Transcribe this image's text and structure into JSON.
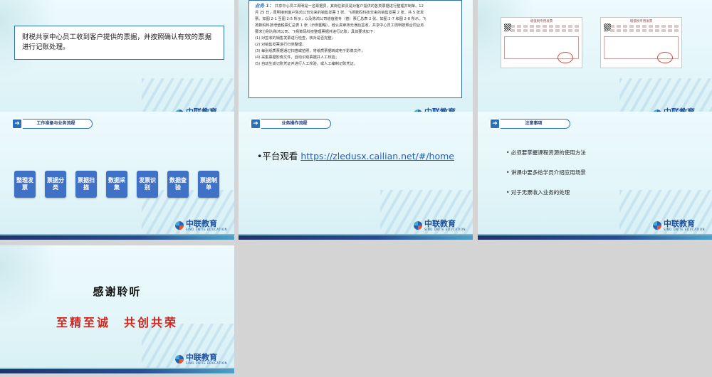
{
  "brand": {
    "logo_text": "中联教育",
    "logo_sub": "SINO UNITE EDUCATION"
  },
  "slide1": {
    "text": "财税共享中心员工收到客户提供的票据，并按照确认有效的票据进行记账处理。"
  },
  "slide2": {
    "tag": "业务 1：",
    "lines": [
      "共享中心员工周明是一名票据员，其岗位职责是对客户提供的各类票据进行整理并制单。12",
      "月 25 日，周明接到客户陈鸿公司交来的销售发票 3 张、飞扬数码科技交来的销售发票 2 张、共 5 张发",
      "票。如图 2-1 至图 2-5 所示，以及陈鸿公司增值税专（普）票汇总表 2 张、如图 2-7 和图 2-8 所示、飞",
      "扬数码科技增值税票汇总表 1 张（示例图略）。经认真审核无误后签收，共享中心员工周明按照合同业务",
      "要求分别为陈鸿公司、飞扬数码科技整理票据并进行记账，具体要求如下：",
      "(1) 对签收的销售发票进行检查，核对是否完整；",
      "(2) 对销售发票进行归类整理；",
      "(3) 每张纸质票据通过扫描或拍照，将纸质票据转成电子影像文件；",
      "(4) 采集票据影像文件，自动识别票据并人工校验；",
      "(5) 自动生成记账凭证并进行人工校验，或人工编制记账凭证。"
    ]
  },
  "slide3": {
    "invoice_header": "增值税专用发票"
  },
  "slide4": {
    "header": "工作准备与业务流程",
    "steps": [
      "整理发票",
      "票据分类",
      "票据扫描",
      "数据采集",
      "发票识别",
      "数据查验",
      "票据制单"
    ]
  },
  "slide5": {
    "header": "业务操作流程",
    "bullet_prefix": "•平台观看 ",
    "link": "https://zledusx.cailian.net/#/home"
  },
  "slide6": {
    "header": "注意事项",
    "notes": [
      "• 必须要掌握课程资源的使用方法",
      "• 讲课中要多给学员介绍应用场景",
      "• 对于无票收入业务的处理"
    ]
  },
  "slide7": {
    "thanks": "感谢聆听",
    "motto": "至精至诚　共创共荣"
  }
}
